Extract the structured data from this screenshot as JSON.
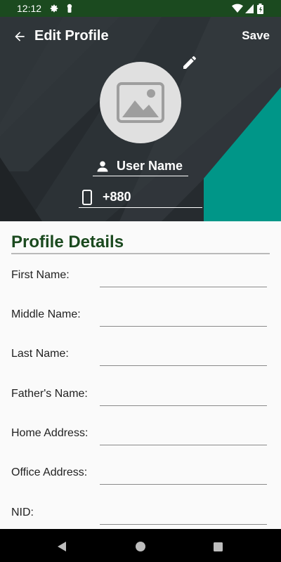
{
  "status_bar": {
    "time": "12:12",
    "icons": [
      "gear-icon",
      "notification-icon",
      "wifi-icon",
      "signal-icon",
      "battery-icon"
    ]
  },
  "toolbar": {
    "title": "Edit Profile",
    "save_label": "Save",
    "back_icon": "arrow-left-icon"
  },
  "profile": {
    "avatar_icon": "image-placeholder-icon",
    "edit_icon": "pencil-icon",
    "username": "User Name",
    "phone": "+880"
  },
  "details": {
    "title": "Profile Details",
    "fields": [
      {
        "label": "First Name:",
        "value": ""
      },
      {
        "label": "Middle Name:",
        "value": ""
      },
      {
        "label": "Last Name:",
        "value": ""
      },
      {
        "label": "Father's Name:",
        "value": ""
      },
      {
        "label": "Home Address:",
        "value": ""
      },
      {
        "label": "Office Address:",
        "value": ""
      },
      {
        "label": "NID:",
        "value": ""
      }
    ]
  },
  "colors": {
    "status_bar": "#1b4a1f",
    "accent": "#009688",
    "header_bg": "#2a2f33",
    "title_text": "#1b4a1f"
  },
  "nav_bar": {
    "icons": [
      "back-triangle-icon",
      "home-circle-icon",
      "recents-square-icon"
    ]
  }
}
